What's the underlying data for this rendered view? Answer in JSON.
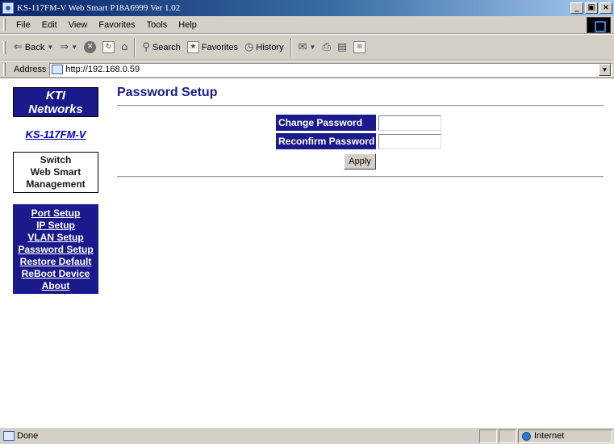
{
  "window": {
    "title": "KS-117FM-V Web Smart P18A6999 Ver 1.02",
    "minimize": "_",
    "restore": "▣",
    "close": "×"
  },
  "menu": {
    "items": [
      "File",
      "Edit",
      "View",
      "Favorites",
      "Tools",
      "Help"
    ]
  },
  "toolbar": {
    "back_label": "Back",
    "search_label": "Search",
    "favorites_label": "Favorites",
    "history_label": "History"
  },
  "address": {
    "label": "Address",
    "url": "http://192.168.0.59"
  },
  "sidebar": {
    "logo_line1": "KTI",
    "logo_line2": "Networks",
    "model": "KS-117FM-V",
    "mgmt_line1": "Switch",
    "mgmt_line2": "Web Smart",
    "mgmt_line3": "Management",
    "nav": [
      "Port Setup",
      "IP Setup",
      "VLAN Setup",
      "Password Setup",
      "Restore Default",
      "ReBoot Device",
      "About"
    ]
  },
  "main": {
    "title": "Password Setup",
    "change_label": "Change Password",
    "change_value": "",
    "reconfirm_label": "Reconfirm Password",
    "reconfirm_value": "",
    "apply_label": "Apply"
  },
  "status": {
    "text": "Done",
    "zone": "Internet"
  }
}
